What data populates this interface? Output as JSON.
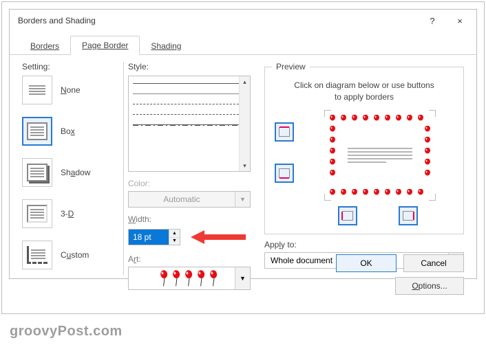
{
  "window": {
    "title": "Borders and Shading",
    "help": "?",
    "close": "×"
  },
  "tabs": {
    "borders": "Borders",
    "page_border": "Page Border",
    "shading": "Shading"
  },
  "setting": {
    "label": "Setting:",
    "none": "None",
    "box": "Box",
    "shadow": "Shadow",
    "threed": "3-D",
    "custom": "Custom"
  },
  "style": {
    "label": "Style:",
    "color_label": "Color:",
    "color_value": "Automatic",
    "width_label": "Width:",
    "width_value": "18 pt",
    "art_label": "Art:"
  },
  "preview": {
    "legend": "Preview",
    "hint1": "Click on diagram below or use buttons",
    "hint2": "to apply borders"
  },
  "apply": {
    "label": "Apply to:",
    "value": "Whole document",
    "options": "Options..."
  },
  "footer": {
    "ok": "OK",
    "cancel": "Cancel"
  },
  "watermark": "groovyPost.com"
}
